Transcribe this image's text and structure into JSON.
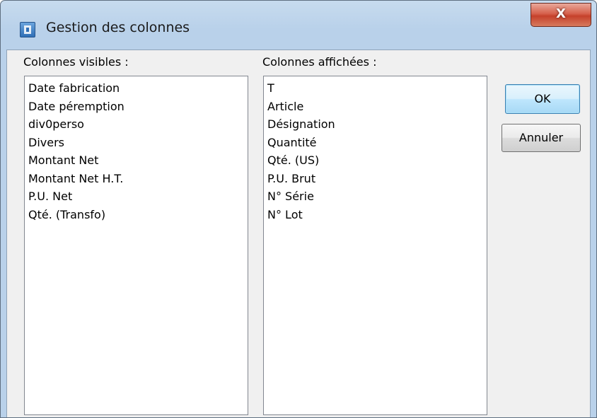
{
  "window": {
    "title": "Gestion des colonnes",
    "close_glyph": "X",
    "icon": "app-window-icon"
  },
  "left_list": {
    "label": "Colonnes visibles :",
    "items": [
      "Date fabrication",
      "Date péremption",
      "div0perso",
      "Divers",
      "Montant Net",
      "Montant Net H.T.",
      "P.U. Net",
      "Qté. (Transfo)"
    ]
  },
  "right_list": {
    "label": "Colonnes affichées :",
    "items": [
      "T",
      "Article",
      "Désignation",
      "Quantité",
      "Qté. (US)",
      "P.U. Brut",
      "N° Série",
      "N° Lot"
    ]
  },
  "buttons": {
    "ok": "OK",
    "cancel": "Annuler"
  },
  "colors": {
    "frame": "#b9d1ea",
    "client": "#f0f0f0",
    "close_button": "#c5412b",
    "default_button_border": "#3c7fb1"
  }
}
